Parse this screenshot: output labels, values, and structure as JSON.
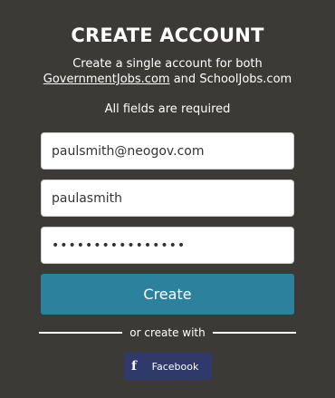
{
  "header": {
    "title": "CREATE ACCOUNT",
    "subtitle_prefix": "Create a single account for both",
    "link_government": "GovernmentJobs.com",
    "subtitle_and": "and",
    "link_school": "SchoolJobs.com",
    "required_note": "All fields are required"
  },
  "form": {
    "email_value": "paulsmith@neogov.com",
    "username_value": "paulasmith",
    "password_value": "••••••••••••••••",
    "create_label": "Create"
  },
  "alternate": {
    "divider_text": "or create with",
    "facebook_icon": "f",
    "facebook_label": "Facebook"
  },
  "colors": {
    "background": "#3b3a37",
    "create_button": "#2c829d",
    "facebook_button": "#2f3a6b"
  }
}
